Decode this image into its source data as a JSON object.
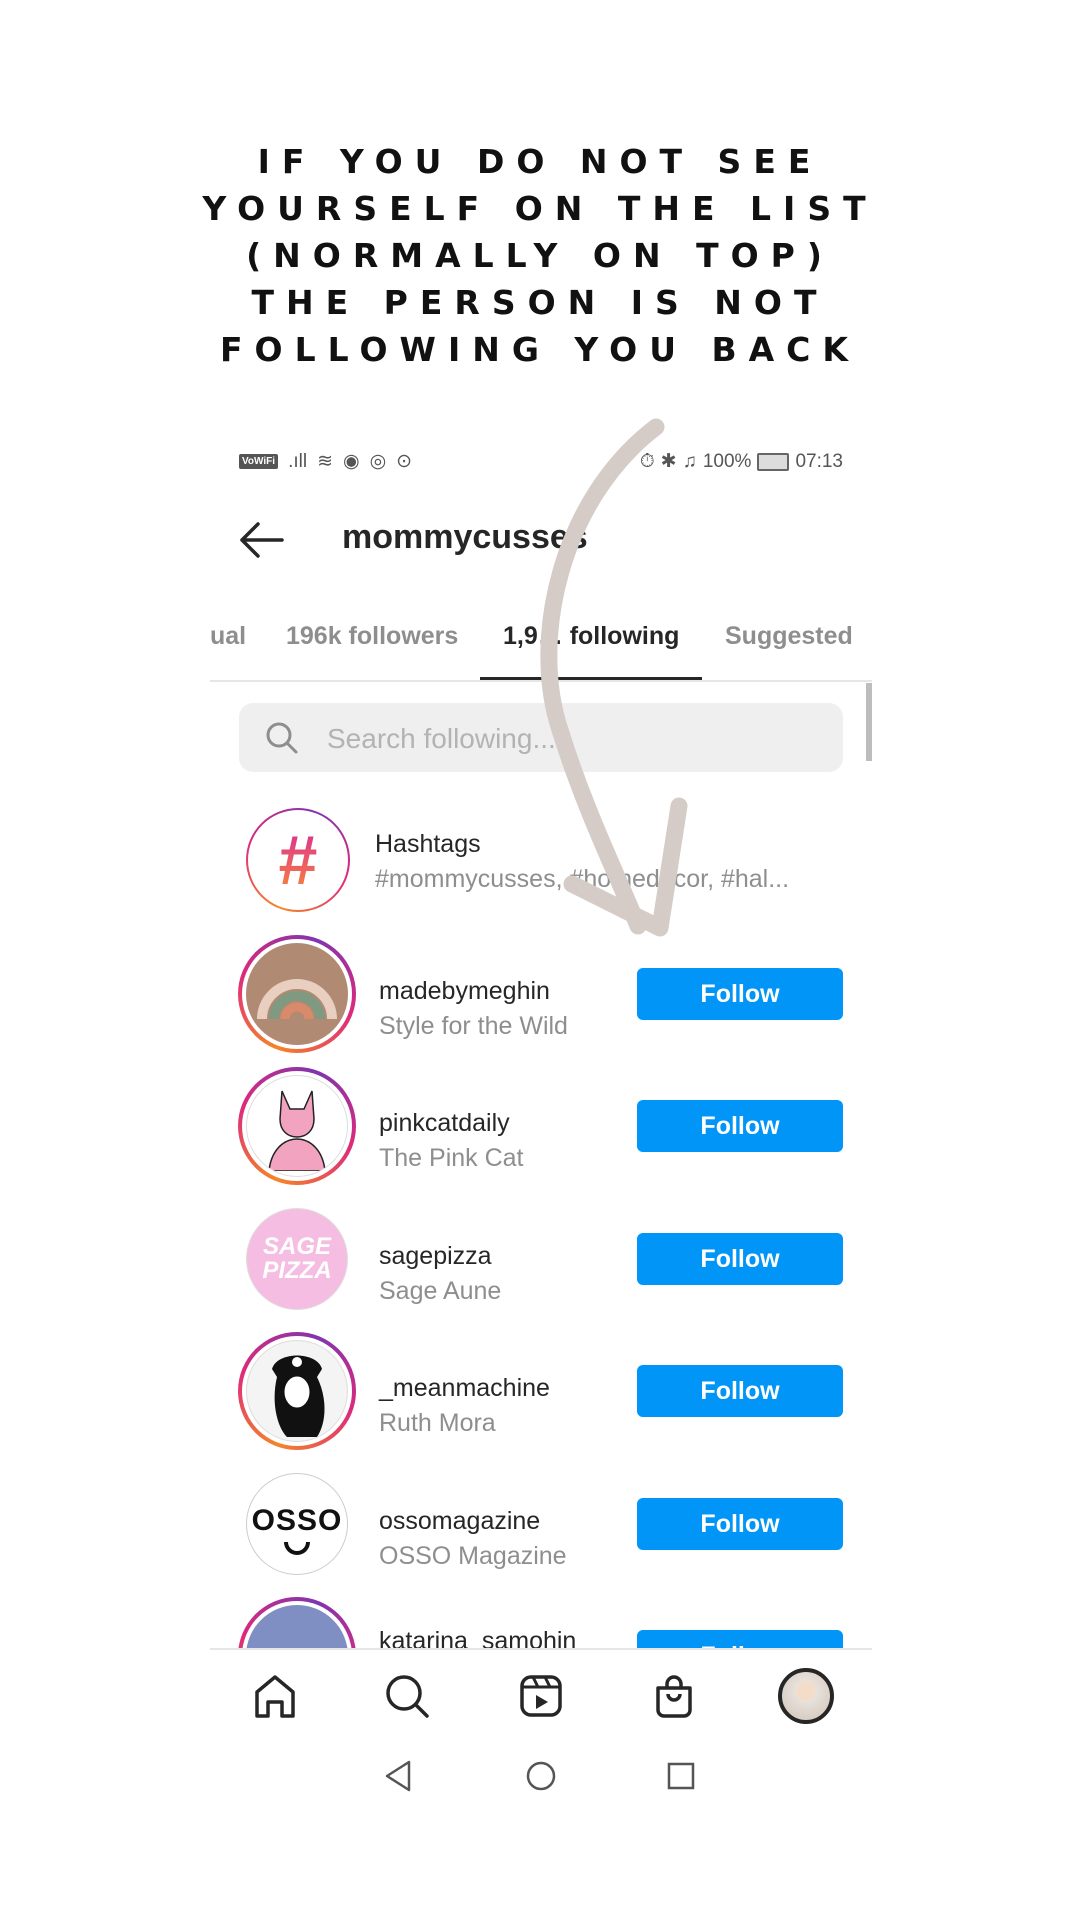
{
  "heading": {
    "lines": [
      "IF YOU DO NOT SEE",
      "YOURSELF ON THE LIST",
      "(NORMALLY ON TOP)",
      "THE PERSON IS NOT",
      "FOLLOWING YOU BACK"
    ]
  },
  "status_bar": {
    "vowifi": "VoWiFi",
    "battery": "100%",
    "time": "07:13"
  },
  "header": {
    "title": "mommycusses",
    "back_icon": "arrow-left-icon"
  },
  "tabs": [
    {
      "label": "ual"
    },
    {
      "label": "196k followers"
    },
    {
      "label": "1,9… following",
      "active": true
    },
    {
      "label": "Suggested"
    }
  ],
  "search": {
    "placeholder": "Search following..."
  },
  "hashtags": {
    "title": "Hashtags",
    "subtitle": "#mommycusses, #homedecor, #hal..."
  },
  "list": [
    {
      "username": "madebymeghin",
      "name": "Style for the Wild",
      "button": "Follow",
      "story_ring": true
    },
    {
      "username": "pinkcatdaily",
      "name": "The Pink Cat",
      "button": "Follow",
      "story_ring": true
    },
    {
      "username": "sagepizza",
      "name": "Sage Aune",
      "button": "Follow",
      "story_ring": false,
      "logo_text": "SAGE PIZZA"
    },
    {
      "username": "_meanmachine",
      "name": "Ruth Mora",
      "button": "Follow",
      "story_ring": true
    },
    {
      "username": "ossomagazine",
      "name": "OSSO Magazine",
      "button": "Follow",
      "story_ring": false,
      "logo_text": "OSSO"
    },
    {
      "username": "katarina_samohin",
      "name": "",
      "button": "Follow",
      "story_ring": true
    }
  ],
  "bottom_nav": [
    "home-icon",
    "search-icon",
    "reels-icon",
    "shop-icon",
    "profile-avatar"
  ],
  "system_nav": [
    "back-triangle-icon",
    "home-circle-icon",
    "recents-square-icon"
  ],
  "colors": {
    "follow_button": "#0095f6",
    "arrow_annotation": "#d5ccc8",
    "active_tab": "#262626",
    "muted_text": "#8e8e8e"
  }
}
